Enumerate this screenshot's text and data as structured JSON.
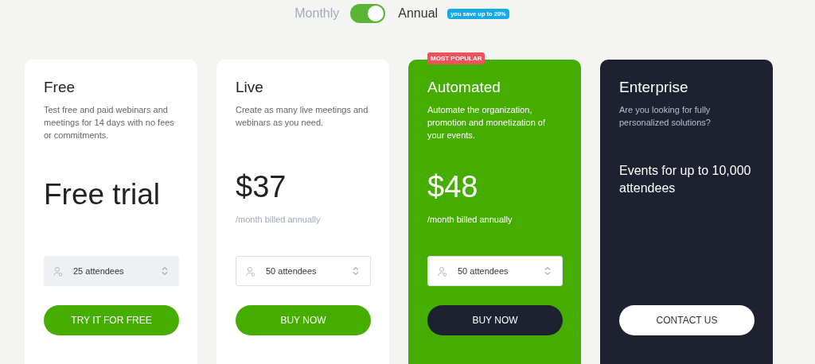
{
  "billing_toggle": {
    "monthly_label": "Monthly",
    "annual_label": "Annual",
    "on": true,
    "savings_badge": "you save up to 20%"
  },
  "plans": [
    {
      "kind": "free",
      "name": "Free",
      "description": "Test free and paid webinars and meetings for 14 days with no fees or commitments.",
      "price": "Free trial",
      "attendees": "25 attendees",
      "button": "TRY IT FOR FREE"
    },
    {
      "kind": "standard",
      "name": "Live",
      "description": "Create as many live meetings and webinars as you need.",
      "price": "$37",
      "period": "/month billed annually",
      "attendees": "50 attendees",
      "button": "BUY NOW"
    },
    {
      "kind": "featured",
      "badge": "MOST POPULAR",
      "name": "Automated",
      "description": "Automate the organization, promotion and monetization of your events.",
      "price": "$48",
      "period": "/month billed annually",
      "attendees": "50 attendees",
      "button": "BUY NOW"
    },
    {
      "kind": "custom",
      "name": "Enterprise",
      "description": "Are you looking for fully personalized solutions?",
      "price": "Events for up to 10,000 attendees",
      "button": "CONTACT US"
    }
  ]
}
